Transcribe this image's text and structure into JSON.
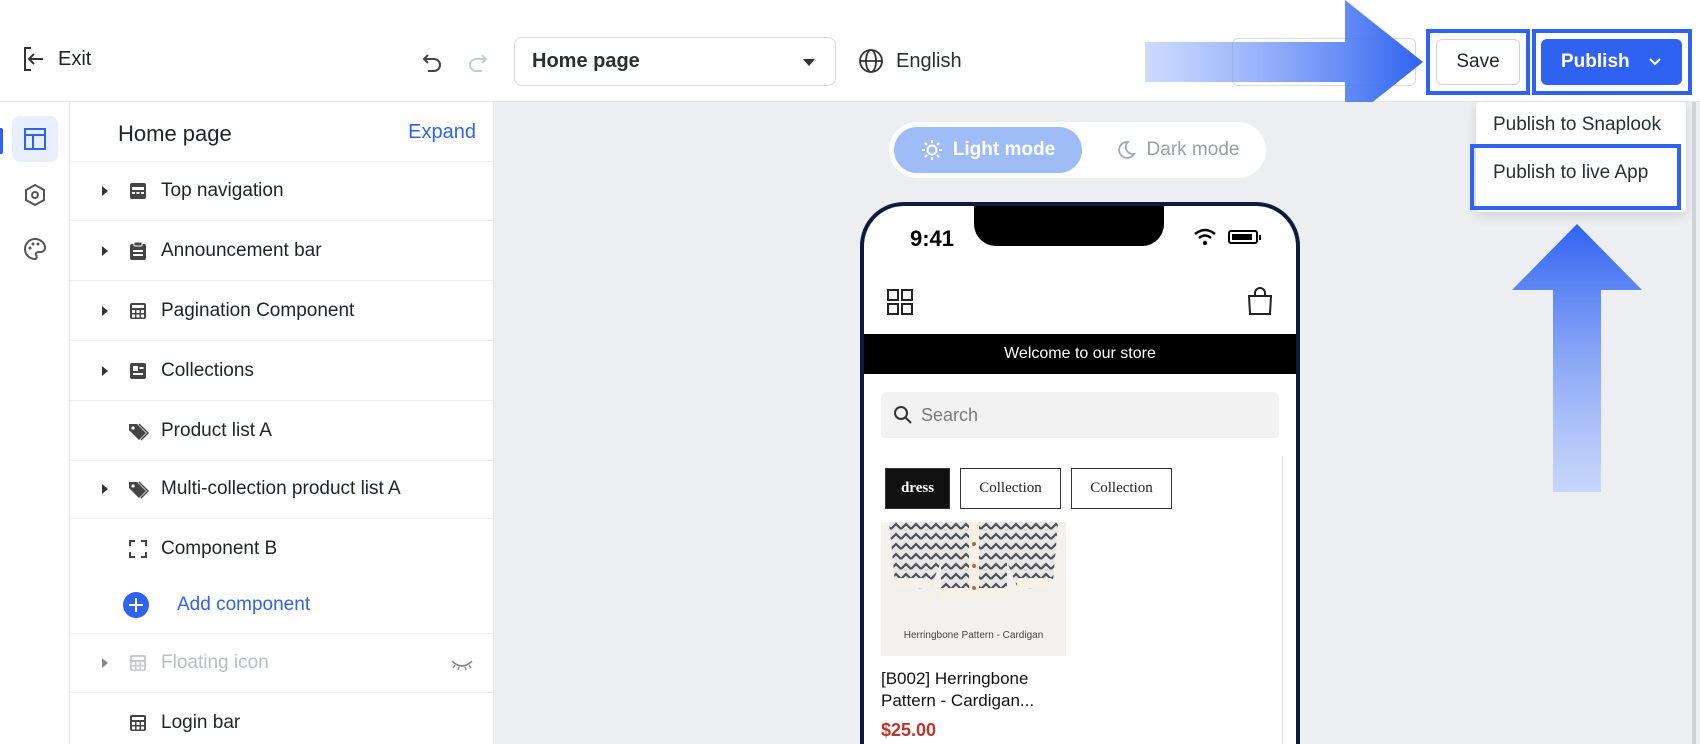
{
  "topbar": {
    "exit_label": "Exit",
    "page_selector": "Home page",
    "language": "English",
    "save_label": "Save",
    "publish_label": "Publish"
  },
  "publish_menu": {
    "items": [
      "Publish to Snaplook",
      "Publish to live App"
    ]
  },
  "sidebar": {
    "title": "Home page",
    "expand_label": "Expand",
    "items": [
      {
        "label": "Top navigation",
        "icon": "nav-bar-icon",
        "expandable": true
      },
      {
        "label": "Announcement bar",
        "icon": "clipboard-icon",
        "expandable": true
      },
      {
        "label": "Pagination Component",
        "icon": "grid-calendar-icon",
        "expandable": true
      },
      {
        "label": "Collections",
        "icon": "collection-card-icon",
        "expandable": true
      },
      {
        "label": "Product list A",
        "icon": "tags-icon",
        "expandable": false
      },
      {
        "label": "Multi-collection product list A",
        "icon": "tags-icon",
        "expandable": true
      },
      {
        "label": "Component B",
        "icon": "frame-corners-icon",
        "expandable": false
      }
    ],
    "add_component_label": "Add component",
    "hidden_items": [
      {
        "label": "Floating icon",
        "icon": "grid-calendar-icon",
        "hidden": true
      },
      {
        "label": "Login bar",
        "icon": "grid-calendar-icon",
        "hidden": false
      }
    ]
  },
  "canvas": {
    "light_mode_label": "Light mode",
    "dark_mode_label": "Dark mode",
    "active_mode": "light"
  },
  "phone": {
    "time": "9:41",
    "announcement": "Welcome to our store",
    "search_placeholder": "Search",
    "chips": [
      "dress",
      "Collection",
      "Collection"
    ],
    "product": {
      "image_caption": "Herringbone Pattern - Cardigan",
      "name": "[B002] Herringbone Pattern - Cardigan...",
      "price": "$25.00"
    }
  },
  "colors": {
    "accent": "#2f62f0",
    "price": "#c0342c",
    "canvas_bg": "#eceef2"
  }
}
